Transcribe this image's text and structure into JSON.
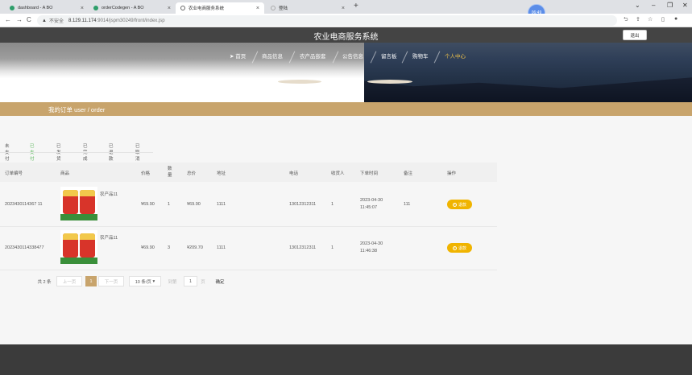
{
  "browser": {
    "tabs": [
      {
        "label": "dashboard - A BO",
        "color": "#2e9e6a"
      },
      {
        "label": "orderCodegen - A BO",
        "color": "#2e9e6a"
      },
      {
        "label": "农业电商服务系统",
        "color": "#666666"
      },
      {
        "label": "登陆",
        "color": "#999999"
      }
    ],
    "new_tab": "+",
    "avatar_text": "06:49",
    "controls": {
      "min": "–",
      "max": "❐",
      "close": "✕",
      "chevron": "⌄"
    },
    "address": {
      "insecure": "不安全",
      "host": "8.129.11.174",
      "path": ":9014/jspm30249/front/index.jsp"
    }
  },
  "site": {
    "title": "农业电商服务系统",
    "logout": "退出",
    "menu": [
      {
        "label": "首页",
        "active": false,
        "home": true
      },
      {
        "label": "商品信息",
        "active": false
      },
      {
        "label": "农产品嵌套",
        "active": false
      },
      {
        "label": "公告信息",
        "active": false
      },
      {
        "label": "留言板",
        "active": false
      },
      {
        "label": "购物车",
        "active": false
      },
      {
        "label": "个人中心",
        "active": true
      }
    ],
    "breadcrumb": "我的订单  user / order"
  },
  "order_tabs": [
    "未支付",
    "已支付",
    "已发货",
    "已完成",
    "已退款",
    "已取消"
  ],
  "active_tab": "已支付",
  "table": {
    "headers": {
      "order_no": "订单编号",
      "product": "商品",
      "price": "价格",
      "qty": "数量",
      "total": "总价",
      "address": "地址",
      "phone": "电话",
      "receiver": "收货人",
      "time": "下单时间",
      "remark": "备注",
      "action": "操作"
    },
    "rows": [
      {
        "order_no": "2023430114367 11",
        "product": "农产品11",
        "price": "¥69.90",
        "qty": "1",
        "total": "¥69.90",
        "address": "1111",
        "phone": "13012312311",
        "receiver": "1",
        "date": "2023-04-30",
        "time": "11:45:07",
        "remark": "111",
        "action": "退款"
      },
      {
        "order_no": "2023430114338477",
        "product": "农产品11",
        "price": "¥69.90",
        "qty": "3",
        "total": "¥209.70",
        "address": "1111",
        "phone": "13012312311",
        "receiver": "1",
        "date": "2023-04-30",
        "time": "11:46:38",
        "remark": "",
        "action": "退款"
      }
    ]
  },
  "pager": {
    "total": "共 2 条",
    "prev": "上一页",
    "page": "1",
    "next": "下一页",
    "size": "10 条/页",
    "goto": "到第",
    "goto_value": "1",
    "page_unit": "页",
    "confirm": "确定"
  }
}
